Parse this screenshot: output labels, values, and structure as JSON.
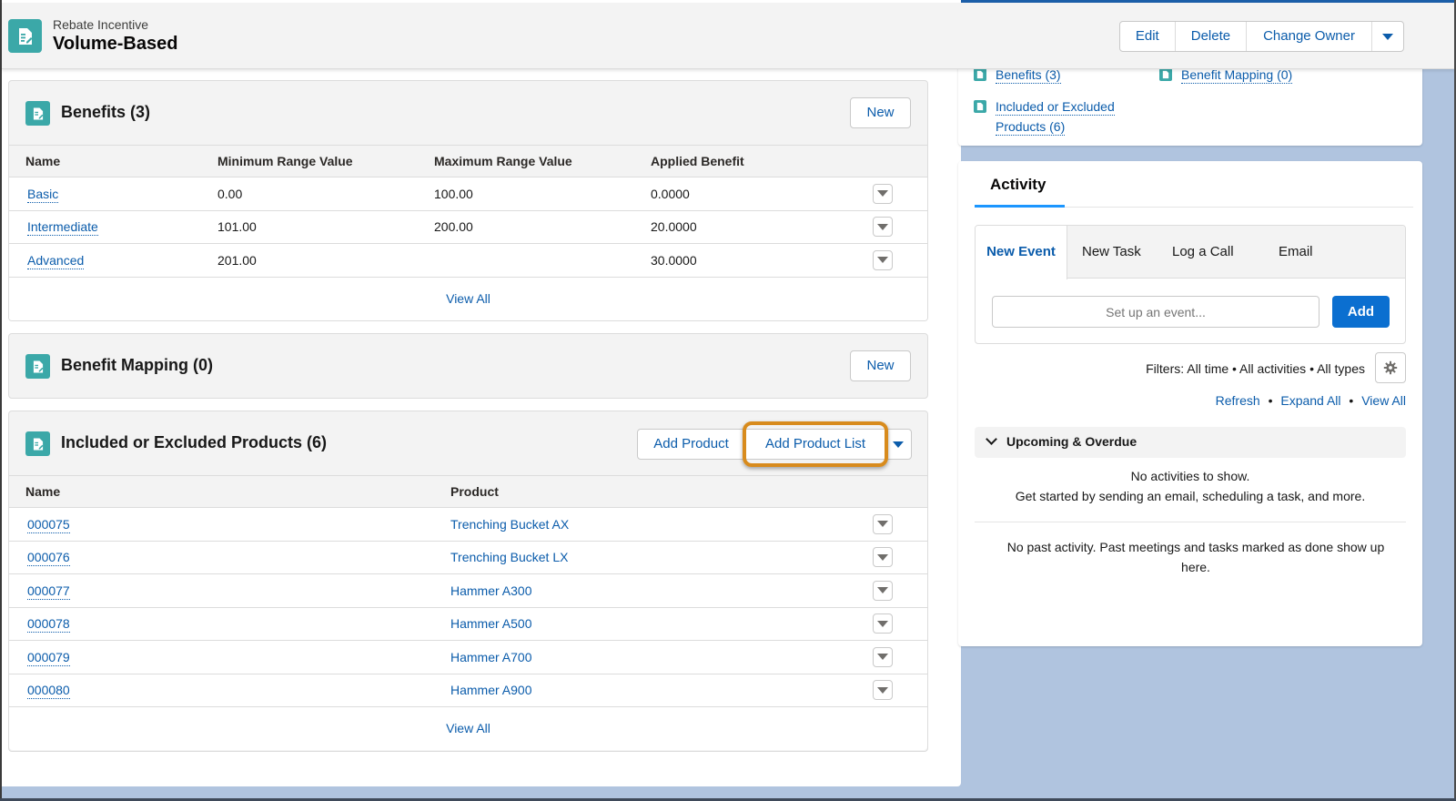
{
  "header": {
    "object_type": "Rebate Incentive",
    "record_name": "Volume-Based",
    "icon": "record-doc-icon",
    "actions": [
      "Edit",
      "Delete",
      "Change Owner"
    ],
    "more_actions_icon": "chevron-down-icon"
  },
  "benefits": {
    "title": "Benefits (3)",
    "new_label": "New",
    "columns": [
      "Name",
      "Minimum Range Value",
      "Maximum Range Value",
      "Applied Benefit"
    ],
    "rows": [
      {
        "name": "Basic",
        "min": "0.00",
        "max": "100.00",
        "applied": "0.0000"
      },
      {
        "name": "Intermediate",
        "min": "101.00",
        "max": "200.00",
        "applied": "20.0000"
      },
      {
        "name": "Advanced",
        "min": "201.00",
        "max": "",
        "applied": "30.0000"
      }
    ],
    "view_all": "View All"
  },
  "benefit_mapping": {
    "title": "Benefit Mapping (0)",
    "new_label": "New"
  },
  "products": {
    "title": "Included or Excluded Products (6)",
    "add_product_label": "Add Product",
    "add_product_list_label": "Add Product List",
    "columns": [
      "Name",
      "Product"
    ],
    "rows": [
      {
        "name": "000075",
        "product": "Trenching Bucket AX"
      },
      {
        "name": "000076",
        "product": "Trenching Bucket LX"
      },
      {
        "name": "000077",
        "product": "Hammer A300"
      },
      {
        "name": "000078",
        "product": "Hammer A500"
      },
      {
        "name": "000079",
        "product": "Hammer A700"
      },
      {
        "name": "000080",
        "product": "Hammer A900"
      }
    ],
    "view_all": "View All"
  },
  "related_links": {
    "items": [
      "Benefits (3)",
      "Benefit Mapping (0)",
      "Included or Excluded",
      "Products (6)"
    ]
  },
  "activity": {
    "title": "Activity",
    "tabs": [
      "New Event",
      "New Task",
      "Log a Call",
      "Email"
    ],
    "active_tab": "New Event",
    "input_placeholder": "Set up an event...",
    "add_label": "Add",
    "filters": "Filters: All time • All activities • All types",
    "links": [
      "Refresh",
      "Expand All",
      "View All"
    ],
    "link_separator": "•",
    "upcoming_label": "Upcoming & Overdue",
    "empty_line1": "No activities to show.",
    "empty_line2": "Get started by sending an email, scheduling a task, and more.",
    "past_line1": "No past activity. Past meetings and tasks marked as done show up",
    "past_line2": "here."
  },
  "colors": {
    "brand_blue": "#0b5cab",
    "icon_teal": "#3ba8a8",
    "highlight_orange": "#d88b1d",
    "primary_button": "#0b6fd0",
    "background": "#b0c4df"
  }
}
